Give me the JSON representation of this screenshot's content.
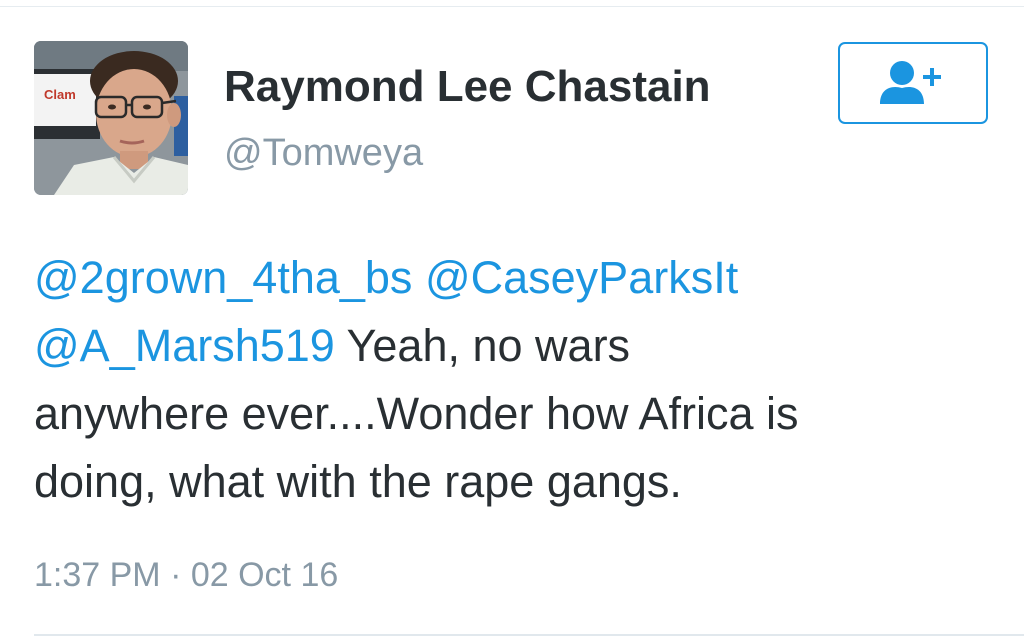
{
  "author": {
    "display_name": "Raymond Lee Chastain",
    "screen_name": "@Tomweya",
    "avatar_sign_text": "Clam"
  },
  "follow_button": {
    "icon": "follow-user-plus-icon"
  },
  "tweet": {
    "lines": [
      [
        {
          "text": "@2grown_4tha_bs",
          "mention": true
        },
        {
          "text": " ",
          "mention": false
        },
        {
          "text": "@CaseyParksIt",
          "mention": true
        }
      ],
      [
        {
          "text": "@A_Marsh519",
          "mention": true
        },
        {
          "text": " Yeah, no wars",
          "mention": false
        }
      ],
      [
        {
          "text": "anywhere ever....Wonder how Africa is",
          "mention": false
        }
      ],
      [
        {
          "text": "doing, what with the rape gangs.",
          "mention": false
        }
      ]
    ],
    "timestamp": "1:37 PM · 02 Oct 16"
  },
  "colors": {
    "link": "#1b95e0",
    "text": "#292f33",
    "muted": "#8899a6"
  }
}
